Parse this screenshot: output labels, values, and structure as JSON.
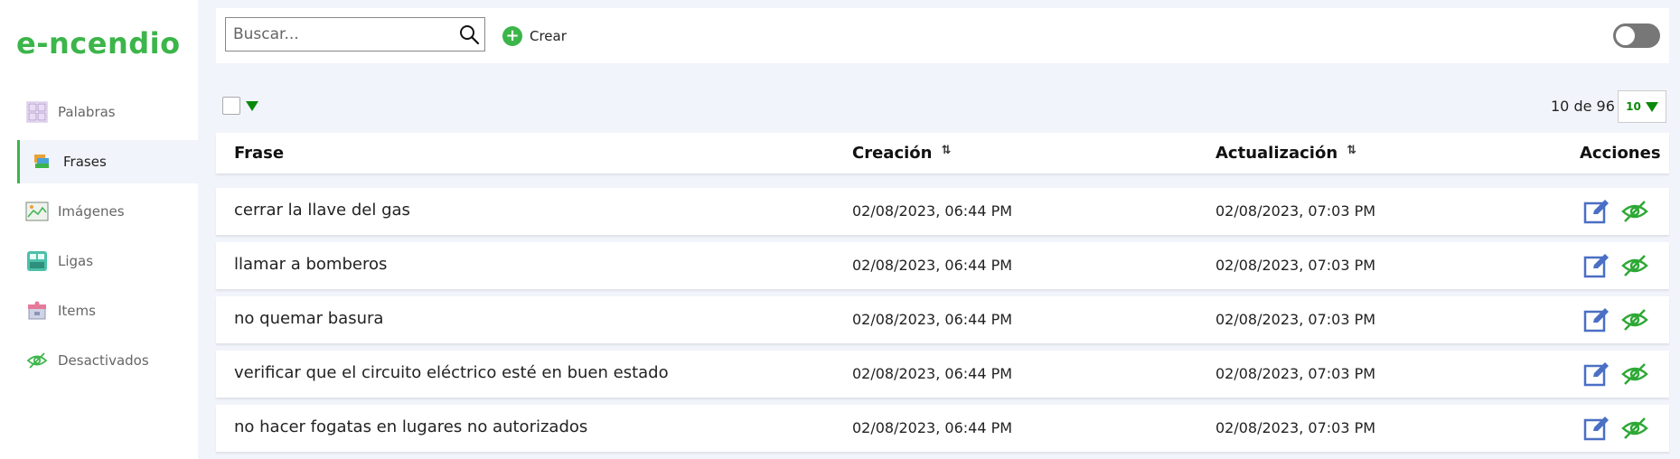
{
  "app": {
    "logo_text": "e-ncendio",
    "brand_color": "#3cb54a",
    "accent_color": "#0a8a0a",
    "link_icon_color": "#4a6fc4"
  },
  "sidebar": {
    "items": [
      {
        "label": "Palabras",
        "icon": "word-grid-icon",
        "active": false
      },
      {
        "label": "Frases",
        "icon": "phrase-cards-icon",
        "active": true
      },
      {
        "label": "Imágenes",
        "icon": "image-icon",
        "active": false
      },
      {
        "label": "Ligas",
        "icon": "link-cards-icon",
        "active": false
      },
      {
        "label": "Items",
        "icon": "items-box-icon",
        "active": false
      },
      {
        "label": "Desactivados",
        "icon": "eye-slash-icon",
        "active": false
      }
    ]
  },
  "toolbar": {
    "search_placeholder": "Buscar...",
    "search_value": "",
    "create_label": "Crear",
    "toggle_on": false
  },
  "pagination": {
    "summary": "10 de 96",
    "per_page": "10"
  },
  "table": {
    "columns": [
      {
        "label": "Frase",
        "sortable": false
      },
      {
        "label": "Creación",
        "sortable": true
      },
      {
        "label": "Actualización",
        "sortable": true
      },
      {
        "label": "Acciones",
        "sortable": false
      }
    ],
    "rows": [
      {
        "frase": "cerrar la llave del gas",
        "creacion": "02/08/2023, 06:44 PM",
        "actualizacion": "02/08/2023, 07:03 PM"
      },
      {
        "frase": "llamar a bomberos",
        "creacion": "02/08/2023, 06:44 PM",
        "actualizacion": "02/08/2023, 07:03 PM"
      },
      {
        "frase": "no quemar basura",
        "creacion": "02/08/2023, 06:44 PM",
        "actualizacion": "02/08/2023, 07:03 PM"
      },
      {
        "frase": "verificar que el circuito eléctrico esté en buen estado",
        "creacion": "02/08/2023, 06:44 PM",
        "actualizacion": "02/08/2023, 07:03 PM"
      },
      {
        "frase": "no hacer fogatas en lugares no autorizados",
        "creacion": "02/08/2023, 06:44 PM",
        "actualizacion": "02/08/2023, 07:03 PM"
      }
    ]
  }
}
